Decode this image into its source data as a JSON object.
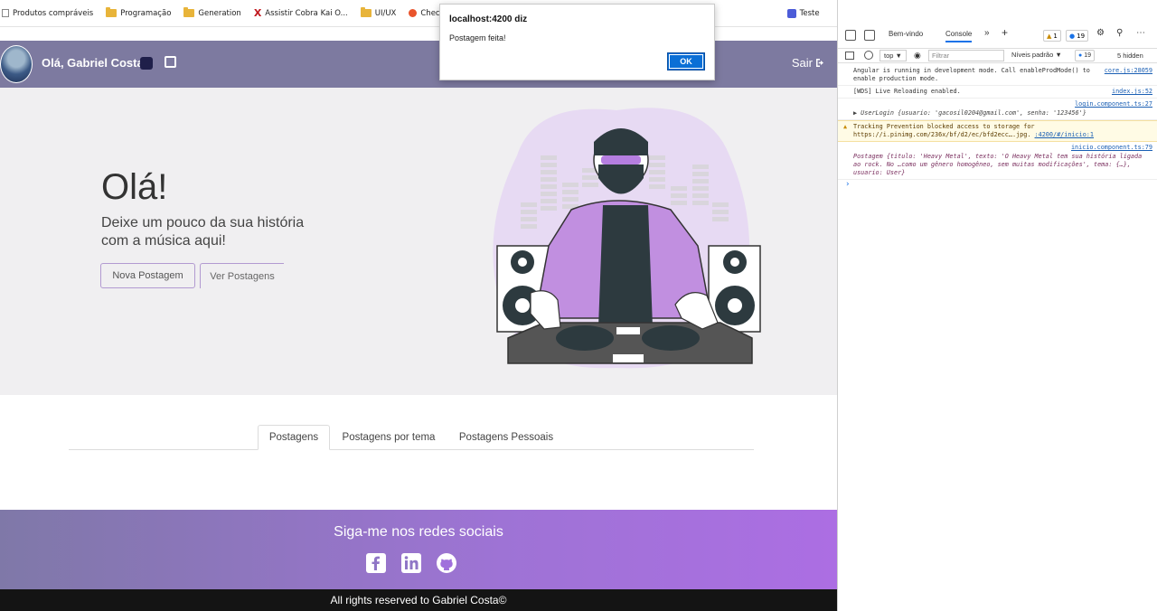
{
  "bookmarks": [
    {
      "label": "Produtos compráveis",
      "icon": "page-icon"
    },
    {
      "label": "Programação",
      "icon": "folder-icon"
    },
    {
      "label": "Generation",
      "icon": "folder-icon"
    },
    {
      "label": "Assistir Cobra Kai O...",
      "icon": "x-icon"
    },
    {
      "label": "UI/UX",
      "icon": "folder-icon"
    },
    {
      "label": "Checkbox HTML: co...",
      "icon": "site-icon"
    },
    {
      "label": "Teste",
      "icon": "teste-icon"
    }
  ],
  "navbar": {
    "greeting": "Olá, Gabriel Costa",
    "logout": "Sair"
  },
  "hero": {
    "title": "Olá!",
    "subtitle": "Deixe um pouco da sua história com a música aqui!",
    "new_post_button": "Nova Postagem",
    "view_posts_button": "Ver Postagens"
  },
  "tabs": [
    "Postagens",
    "Postagens por tema",
    "Postagens Pessoais"
  ],
  "footer": {
    "title": "Siga-me nos redes sociais",
    "copyright": "All rights reserved to Gabriel Costa©"
  },
  "alert": {
    "title": "localhost:4200 diz",
    "message": "Postagem feita!",
    "ok": "OK"
  },
  "devtools": {
    "tab_welcome": "Bem-vindo",
    "tab_console": "Console",
    "warn_count": "1",
    "msg_count": "19",
    "context": "top",
    "filter_placeholder": "Filtrar",
    "levels": "Níveis padrão",
    "levels_count": "19",
    "hidden": "5 hidden",
    "logs": [
      {
        "text": "Angular is running in development mode. Call enableProdMode() to enable production mode.",
        "src": "core.js:28059"
      },
      {
        "text": "[WDS] Live Reloading enabled.",
        "src": "index.js:52"
      },
      {
        "text": "▶ UserLogin {usuario: 'gacosil0204@gmail.com', senha: '123456'}",
        "src": "login.component.ts:27"
      },
      {
        "text": "Tracking Prevention blocked access to storage for https://i.pinimg.com/236x/bf/d2/ec/bfd2ecc….jpg.",
        "src": ":4200/#/inicio:1"
      },
      {
        "text": "Postagem {titulo: 'Heavy Metal', texto: 'O Heavy Metal tem sua história ligada ao rock. No …como um gênero homogêneo, sem muitas modificações', tema: {…}, usuario: User}",
        "src": "inicio.component.ts:79"
      }
    ]
  }
}
